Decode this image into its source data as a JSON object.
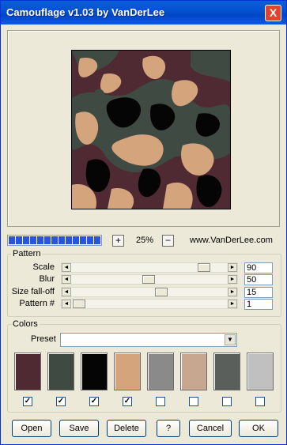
{
  "window": {
    "title": "Camouflage v1.03 by VanDerLee",
    "close_glyph": "X"
  },
  "zoom": {
    "plus": "+",
    "value": "25%",
    "minus": "−",
    "progress_fraction": 1.0
  },
  "website": "www.VanDerLee.com",
  "pattern": {
    "legend": "Pattern",
    "rows": [
      {
        "label": "Scale",
        "value": "90"
      },
      {
        "label": "Blur",
        "value": "50"
      },
      {
        "label": "Size fall-off",
        "value": "15"
      },
      {
        "label": "Pattern #",
        "value": "1"
      }
    ]
  },
  "colors": {
    "legend": "Colors",
    "preset_label": "Preset",
    "preset_value": "",
    "swatches": [
      {
        "color": "#4f2a33",
        "checked": true
      },
      {
        "color": "#3f4a42",
        "checked": true
      },
      {
        "color": "#050505",
        "checked": true
      },
      {
        "color": "#d4a57c",
        "checked": true
      },
      {
        "color": "#8a8a8a",
        "checked": false
      },
      {
        "color": "#c8a790",
        "checked": false
      },
      {
        "color": "#5b5f5c",
        "checked": false
      },
      {
        "color": "#c0c0c0",
        "checked": false
      }
    ]
  },
  "buttons": {
    "open": "Open",
    "save": "Save",
    "delete": "Delete",
    "help": "?",
    "cancel": "Cancel",
    "ok": "OK"
  }
}
